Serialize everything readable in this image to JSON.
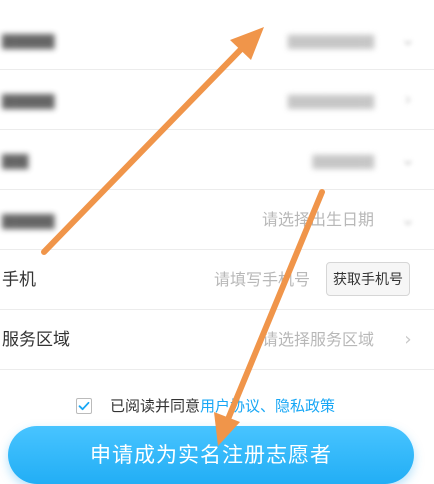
{
  "form": {
    "rows": [
      {
        "label": "",
        "value": "",
        "has_chevron": true
      },
      {
        "label": "",
        "value": "",
        "has_chevron": true
      },
      {
        "label": "",
        "value": "",
        "has_chevron": true
      },
      {
        "label": "",
        "value": "请选择出生日期",
        "has_chevron": true
      },
      {
        "label": "手机",
        "placeholder": "请填写手机号",
        "button": "获取手机号"
      },
      {
        "label": "服务区域",
        "value": "请选择服务区域",
        "has_chevron": true
      }
    ]
  },
  "agreement": {
    "checked": true,
    "prefix": "已阅读并同意",
    "link1": "用户协议",
    "separator": "、",
    "link2": "隐私政策"
  },
  "submit": {
    "label": "申请成为实名注册志愿者"
  },
  "colors": {
    "accent": "#18a7f5",
    "button": "#2bb3fa",
    "arrow": "#f0954a"
  },
  "annotations": {
    "arrows": 2
  }
}
